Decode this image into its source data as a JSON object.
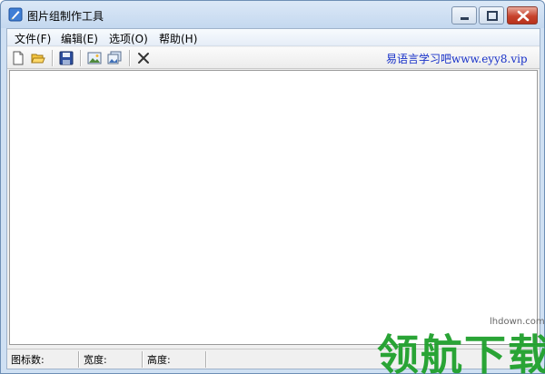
{
  "window": {
    "title": "图片组制作工具"
  },
  "menu": {
    "items": [
      "文件(F)",
      "编辑(E)",
      "选项(O)",
      "帮助(H)"
    ]
  },
  "toolbar": {
    "buttons": [
      {
        "icon": "new-file-icon"
      },
      {
        "icon": "open-folder-icon"
      },
      {
        "icon": "save-icon"
      },
      {
        "icon": "image-icon"
      },
      {
        "icon": "image-group-icon"
      },
      {
        "icon": "delete-icon"
      }
    ],
    "site_link": "易语言学习吧www.eyy8.vip"
  },
  "status": {
    "icon_count_label": "图标数:",
    "width_label": "宽度:",
    "height_label": "高度:"
  },
  "watermark": {
    "text": "领航下载",
    "url": "lhdown.com",
    "color": "#1fa02c"
  },
  "colors": {
    "title_bar": "#c4d8ef",
    "close_button": "#c7432d",
    "link": "#1730c8"
  }
}
